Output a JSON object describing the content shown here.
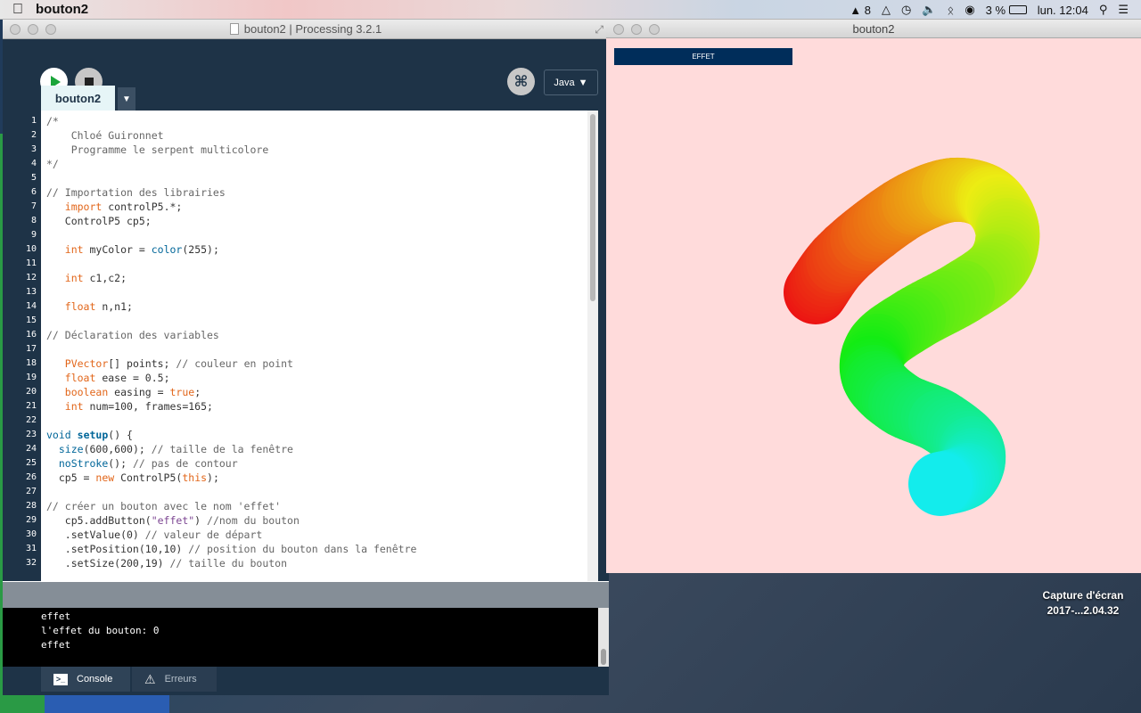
{
  "menubar": {
    "app_name": "bouton2",
    "adobe_count": "8",
    "battery": "3 %",
    "clock": "lun. 12:04"
  },
  "editor": {
    "window_title": "bouton2 | Processing 3.2.1",
    "mode": "Java",
    "tab_name": "bouton2",
    "code_lines": [
      [
        {
          "t": "/*",
          "c": "cm"
        }
      ],
      [
        {
          "t": "    Chloé Guironnet",
          "c": "cm"
        }
      ],
      [
        {
          "t": "    Programme le serpent multicolore",
          "c": "cm"
        }
      ],
      [
        {
          "t": "*/",
          "c": "cm"
        }
      ],
      [],
      [
        {
          "t": "// Importation des librairies",
          "c": "cm"
        }
      ],
      [
        {
          "t": "   "
        },
        {
          "t": "import",
          "c": "kw"
        },
        {
          "t": " controlP5.*;"
        }
      ],
      [
        {
          "t": "   ControlP5 cp5;"
        }
      ],
      [],
      [
        {
          "t": "   "
        },
        {
          "t": "int",
          "c": "kw"
        },
        {
          "t": " myColor = "
        },
        {
          "t": "color",
          "c": "fn"
        },
        {
          "t": "(255);"
        }
      ],
      [],
      [
        {
          "t": "   "
        },
        {
          "t": "int",
          "c": "kw"
        },
        {
          "t": " c1,c2;"
        }
      ],
      [],
      [
        {
          "t": "   "
        },
        {
          "t": "float",
          "c": "kw"
        },
        {
          "t": " n,n1;"
        }
      ],
      [],
      [
        {
          "t": "// Déclaration des variables",
          "c": "cm"
        }
      ],
      [],
      [
        {
          "t": "   "
        },
        {
          "t": "PVector",
          "c": "kw"
        },
        {
          "t": "[] points; "
        },
        {
          "t": "// couleur en point",
          "c": "cm"
        }
      ],
      [
        {
          "t": "   "
        },
        {
          "t": "float",
          "c": "kw"
        },
        {
          "t": " ease = 0.5;"
        }
      ],
      [
        {
          "t": "   "
        },
        {
          "t": "boolean",
          "c": "kw"
        },
        {
          "t": " easing = "
        },
        {
          "t": "true",
          "c": "kw"
        },
        {
          "t": ";"
        }
      ],
      [
        {
          "t": "   "
        },
        {
          "t": "int",
          "c": "kw"
        },
        {
          "t": " num=100, frames=165;"
        }
      ],
      [],
      [
        {
          "t": "void",
          "c": "fn"
        },
        {
          "t": " "
        },
        {
          "t": "setup",
          "c": "fnb"
        },
        {
          "t": "() {"
        }
      ],
      [
        {
          "t": "  "
        },
        {
          "t": "size",
          "c": "fn"
        },
        {
          "t": "(600,600); "
        },
        {
          "t": "// taille de la fenêtre",
          "c": "cm"
        }
      ],
      [
        {
          "t": "  "
        },
        {
          "t": "noStroke",
          "c": "fn"
        },
        {
          "t": "(); "
        },
        {
          "t": "// pas de contour",
          "c": "cm"
        }
      ],
      [
        {
          "t": "  cp5 = "
        },
        {
          "t": "new",
          "c": "kw"
        },
        {
          "t": " ControlP5("
        },
        {
          "t": "this",
          "c": "kw"
        },
        {
          "t": ");"
        }
      ],
      [],
      [
        {
          "t": "// créer un bouton avec le nom 'effet'",
          "c": "cm"
        }
      ],
      [
        {
          "t": "   cp5.addButton("
        },
        {
          "t": "\"effet\"",
          "c": "str"
        },
        {
          "t": ") "
        },
        {
          "t": "//nom du bouton",
          "c": "cm"
        }
      ],
      [
        {
          "t": "   .setValue(0) "
        },
        {
          "t": "// valeur de départ",
          "c": "cm"
        }
      ],
      [
        {
          "t": "   .setPosition(10,10) "
        },
        {
          "t": "// position du bouton dans la fenêtre",
          "c": "cm"
        }
      ],
      [
        {
          "t": "   .setSize(200,19) "
        },
        {
          "t": "// taille du bouton",
          "c": "cm"
        }
      ]
    ],
    "console_lines": [
      "effet",
      "l'effet du bouton: 0",
      "effet"
    ],
    "console_tab": "Console",
    "errors_tab": "Erreurs"
  },
  "sketch": {
    "window_title": "bouton2",
    "button_label": "EFFET",
    "background_color": "#ffdbdb",
    "button_color": "#002d5a"
  },
  "desktop": {
    "file_label_line1": "Capture d'écran",
    "file_label_line2": "2017-...2.04.32"
  }
}
